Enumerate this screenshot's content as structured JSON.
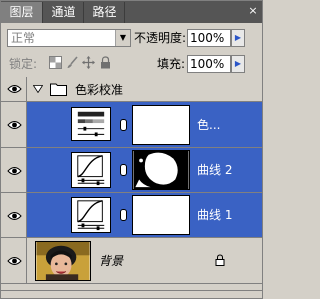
{
  "tabs": [
    {
      "label": "图层",
      "active": true
    },
    {
      "label": "通道",
      "active": false
    },
    {
      "label": "路径",
      "active": false
    }
  ],
  "close_glyph": "×",
  "blend_mode": {
    "value": "正常",
    "arrow": "▼"
  },
  "opacity": {
    "label": "不透明度:",
    "value": "100%",
    "arrow": "▶"
  },
  "lock": {
    "label": "锁定:",
    "icons": [
      "lock-transparent-icon",
      "lock-brush-icon",
      "lock-move-icon",
      "lock-all-icon"
    ]
  },
  "fill": {
    "label": "填充:",
    "value": "100%",
    "arrow": "▶"
  },
  "group": {
    "name": "色彩校准",
    "expanded": true
  },
  "layers": [
    {
      "name": "色...",
      "type": "adjustment-channel-mixer",
      "selected": true
    },
    {
      "name": "曲线 2",
      "type": "adjustment-curves",
      "selected": true
    },
    {
      "name": "曲线 1",
      "type": "adjustment-curves",
      "selected": true
    },
    {
      "name": "背景",
      "type": "image",
      "selected": false,
      "locked": true
    }
  ],
  "colors": {
    "selection": "#3a62c4",
    "panel": "#d4d0c8",
    "tabbar": "#555555"
  }
}
